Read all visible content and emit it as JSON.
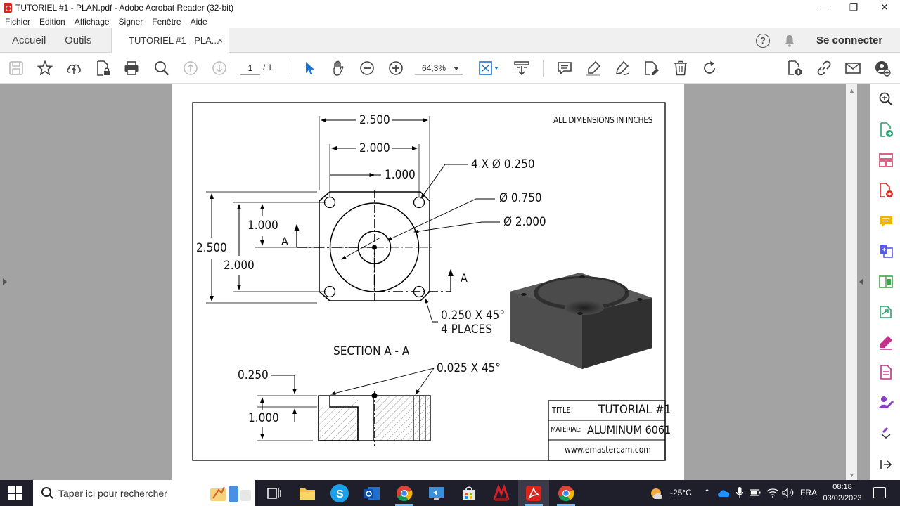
{
  "window": {
    "title": "TUTORIEL #1 - PLAN.pdf - Adobe Acrobat Reader (32-bit)",
    "controls": {
      "minimize": "—",
      "restore": "❐",
      "close": "✕"
    }
  },
  "menu": {
    "items": [
      "Fichier",
      "Edition",
      "Affichage",
      "Signer",
      "Fenêtre",
      "Aide"
    ]
  },
  "tabs": {
    "home": "Accueil",
    "tools": "Outils",
    "document": "TUTORIEL #1 - PLA...",
    "close": "×",
    "help": "?",
    "signin": "Se connecter"
  },
  "toolbar": {
    "page_current": "1",
    "page_total": "/ 1",
    "zoom": "64,3%"
  },
  "drawing": {
    "note": "ALL DIMENSIONS IN INCHES",
    "dims": {
      "width_outer": "2.500",
      "width_holes": "2.000",
      "width_center": "1.000",
      "holes": "4 X Ø 0.250",
      "bore_small": "Ø 0.750",
      "bore_large": "Ø 2.000",
      "height_outer": "2.500",
      "height_holes": "2.000",
      "height_center": "1.000",
      "chamfer_corner": "0.250 X 45°",
      "chamfer_places": "4 PLACES",
      "depth": "0.250",
      "thickness": "1.000",
      "chamfer_edge": "0.025 X 45°"
    },
    "section_marker": "A",
    "section_title": "SECTION A - A",
    "title_block": {
      "title_label": "TITLE:",
      "title_value": "TUTORIAL #1",
      "material_label": "MATERIAL:",
      "material_value": "ALUMINUM 6061",
      "website": "www.emastercam.com"
    }
  },
  "taskbar": {
    "search_placeholder": "Taper ici pour rechercher",
    "temperature": "-25°C",
    "language": "FRA",
    "time": "08:18",
    "date": "03/02/2023"
  }
}
